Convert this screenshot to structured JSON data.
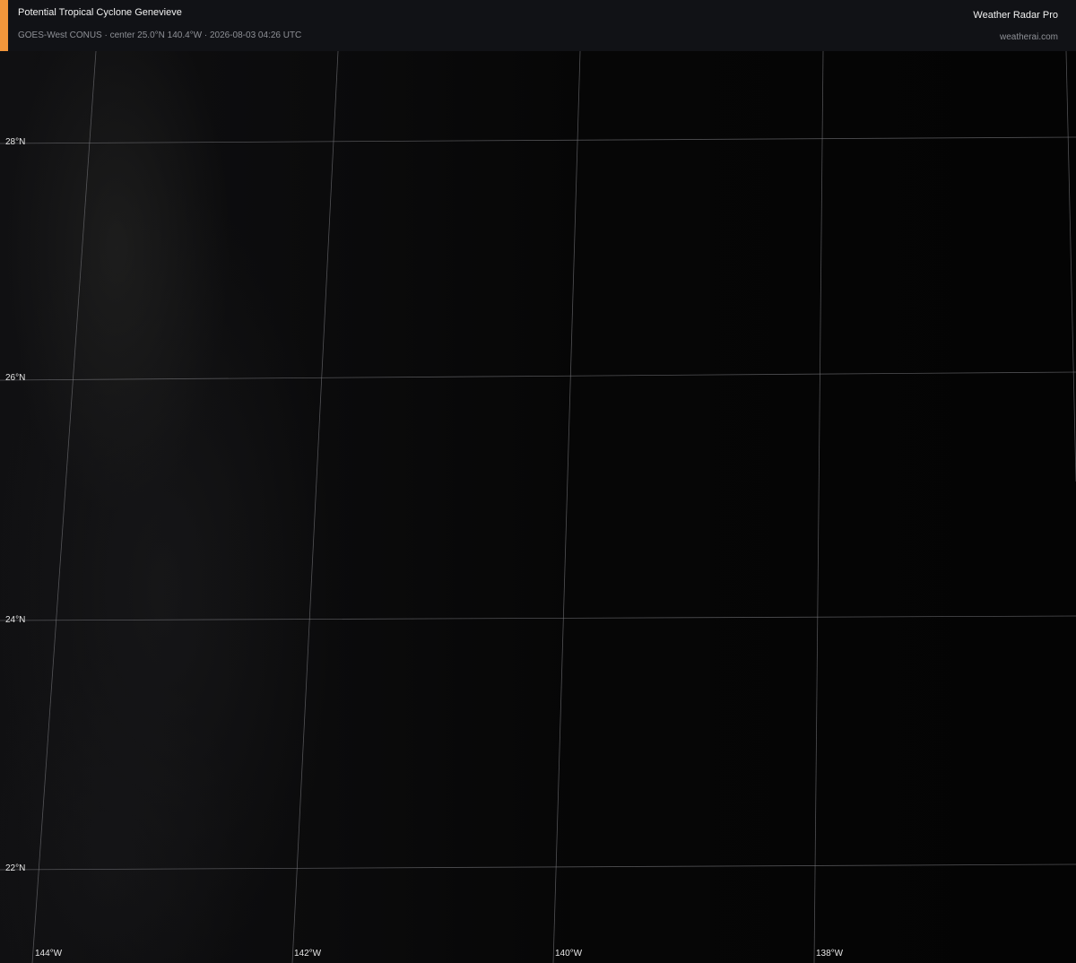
{
  "header": {
    "title": "Potential Tropical Cyclone Genevieve",
    "subtitle": "GOES-West CONUS · center 25.0°N 140.4°W · 2026-08-03 04:26 UTC",
    "brand": "Weather Radar Pro",
    "site": "weatherai.com",
    "accent_color": "#f2963b"
  },
  "map": {
    "lat_labels": [
      "28°N",
      "26°N",
      "24°N",
      "22°N"
    ],
    "lon_labels": [
      "144°W",
      "142°W",
      "140°W",
      "138°W"
    ]
  }
}
